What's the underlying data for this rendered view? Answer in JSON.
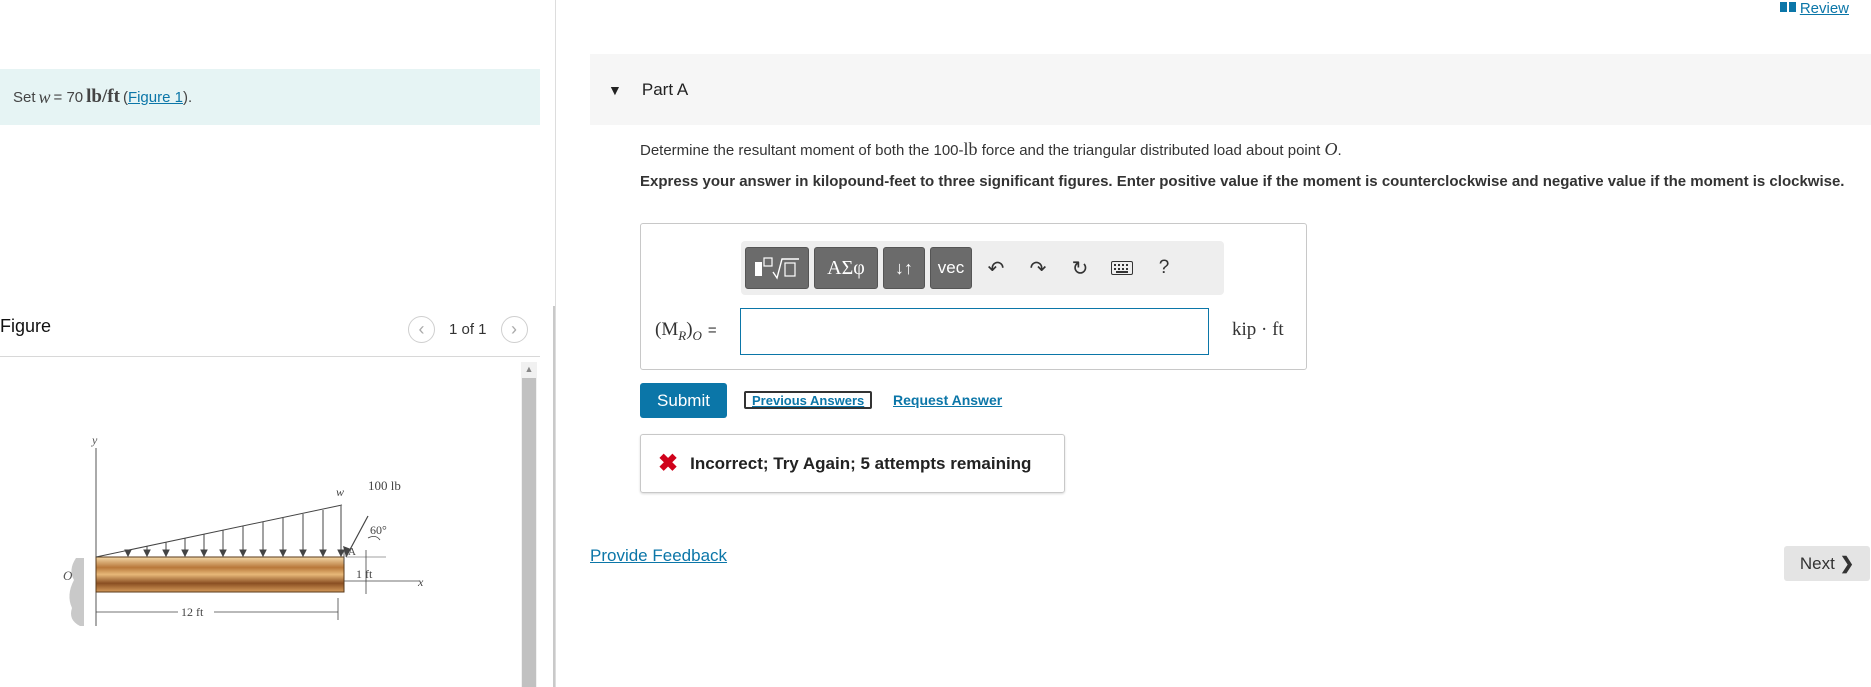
{
  "intro": {
    "prefix": "Set",
    "var_w": "w",
    "equals_value": "= 70",
    "unit": "lb/ft",
    "figure_link": "Figure 1",
    "suffix": ")."
  },
  "figure": {
    "heading": "Figure",
    "page_count": "1 of 1",
    "labels": {
      "y_axis": "y",
      "x_axis": "x",
      "origin": "O",
      "load": "w",
      "force": "100 lb",
      "angle": "60°",
      "point_a": "A",
      "one_ft": "1 ft",
      "twelve_ft": "12 ft"
    }
  },
  "review": {
    "label": "Review"
  },
  "part": {
    "title": "Part A"
  },
  "question": {
    "text_before": "Determine the resultant moment of both the 100-",
    "unit_lb": "lb",
    "text_middle": " force and the triangular distributed load about point ",
    "point": "O",
    "text_after": ".",
    "instructions": "Express your answer in kilopound-feet to three significant figures. Enter positive value if the moment is counterclockwise and negative value if the moment is clockwise."
  },
  "toolbar": {
    "greek": "ΑΣφ",
    "arrows": "↓↑",
    "vec": "vec",
    "help": "?"
  },
  "answer": {
    "label": "(M",
    "label_sub": "R",
    "label_close": ")",
    "label_sub_o": "O",
    "equals": "=",
    "value": "",
    "unit": "kip · ft"
  },
  "actions": {
    "submit": "Submit",
    "previous_answers": "Previous Answers",
    "request_answer": "Request Answer"
  },
  "feedback": {
    "icon": "✖",
    "message": "Incorrect; Try Again; 5 attempts remaining"
  },
  "footer": {
    "provide_feedback": "Provide Feedback",
    "next": "Next"
  },
  "colors": {
    "accent": "#0b76a8",
    "intro_bg": "#e6f4f4",
    "error": "#d0021b"
  }
}
